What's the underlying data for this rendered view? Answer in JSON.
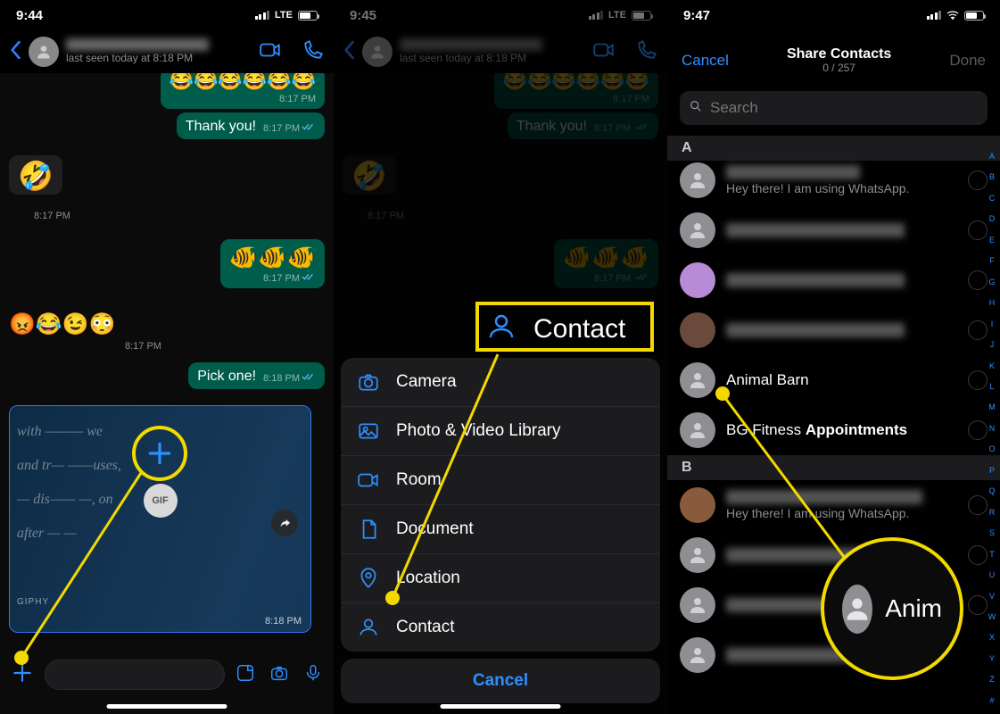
{
  "panel1": {
    "status": {
      "time": "9:44",
      "net": "LTE"
    },
    "header": {
      "last_seen": "last seen today at 8:18 PM"
    },
    "messages": {
      "emoji_row_out_ts": "8:17 PM",
      "thank_you": "Thank you!",
      "thank_you_ts": "8:17 PM",
      "rofl_ts": "8:17 PM",
      "fish_ts": "8:17 PM",
      "mixed_emoji_ts": "8:17 PM",
      "pick_one": "Pick one!",
      "pick_one_ts": "8:18 PM",
      "gif_label": "GIF",
      "giphy": "GIPHY",
      "gif_ts": "8:18 PM"
    }
  },
  "panel2": {
    "status": {
      "time": "9:45",
      "net": "LTE"
    },
    "header": {
      "last_seen": "last seen today at 8:18 PM"
    },
    "sheet": {
      "camera": "Camera",
      "library": "Photo & Video Library",
      "room": "Room",
      "document": "Document",
      "location": "Location",
      "contact": "Contact",
      "cancel": "Cancel"
    },
    "callout_label": "Contact"
  },
  "panel3": {
    "status": {
      "time": "9:47"
    },
    "header": {
      "cancel": "Cancel",
      "title": "Share Contacts",
      "count": "0 / 257",
      "done": "Done"
    },
    "search_placeholder": "Search",
    "sections": {
      "a": "A",
      "b": "B"
    },
    "contacts": {
      "row1_status": "Hey there! I am using WhatsApp.",
      "animal_barn": "Animal Barn",
      "bg_fitness_a": "BG Fitness ",
      "bg_fitness_b": "Appointments",
      "b_row_status": "Hey there! I am using WhatsApp."
    },
    "index_letters": [
      "A",
      "B",
      "C",
      "D",
      "E",
      "F",
      "G",
      "H",
      "I",
      "J",
      "K",
      "L",
      "M",
      "N",
      "O",
      "P",
      "Q",
      "R",
      "S",
      "T",
      "U",
      "V",
      "W",
      "X",
      "Y",
      "Z",
      "#"
    ],
    "zoom_label": "Anim"
  }
}
